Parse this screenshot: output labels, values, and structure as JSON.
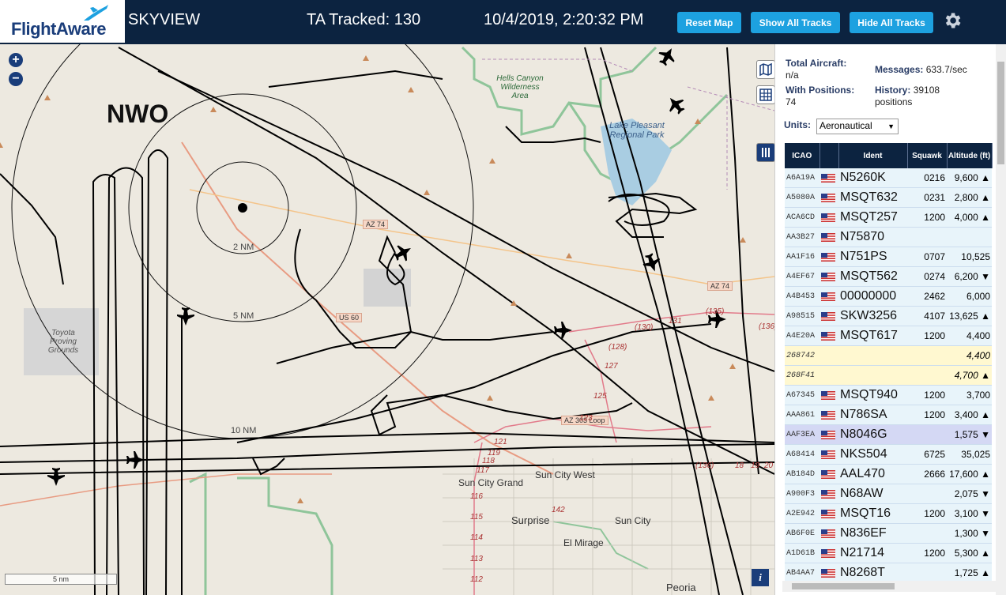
{
  "header": {
    "logo_text": "FlightAware",
    "app_title": "SKYVIEW",
    "ta_tracked": "TA Tracked: 130",
    "clock": "10/4/2019, 2:20:32 PM",
    "btn_reset": "Reset Map",
    "btn_show": "Show All Tracks",
    "btn_hide": "Hide All Tracks",
    "settings_icon": "gear-icon"
  },
  "map": {
    "station_label": "NWO",
    "zoom_in": "+",
    "zoom_out": "−",
    "range_rings": [
      "2 NM",
      "5 NM",
      "10 NM"
    ],
    "labels": {
      "hells_canyon": "Hells Canyon Wilderness Area",
      "lake_pleasant": "Lake Pleasant Regional Park",
      "toyota": "Toyota Proving Grounds",
      "sun_city_grand": "Sun City Grand",
      "sun_city_west": "Sun City West",
      "sun_city": "Sun City",
      "surprise": "Surprise",
      "el_mirage": "El Mirage",
      "peoria": "Peoria"
    },
    "roads": [
      "AZ 74",
      "AZ 74",
      "US 60",
      "AZ 303 Loop"
    ],
    "road_numbers": [
      "(130)",
      "131",
      "(135)",
      "(136)",
      "(128)",
      "127",
      "125",
      "123",
      "121",
      "119",
      "118",
      "117",
      "116",
      "115",
      "114",
      "113",
      "112",
      "142",
      "18",
      "19",
      "20",
      "(136)"
    ],
    "scale": "5 nm",
    "info": "i"
  },
  "panel": {
    "total_aircraft_label": "Total Aircraft:",
    "total_aircraft_value": "n/a",
    "with_positions_label": "With Positions:",
    "with_positions_value": "74",
    "messages_label": "Messages:",
    "messages_value": "633.7/sec",
    "history_label": "History:",
    "history_value": "39108",
    "history_unit": "positions",
    "units_label": "Units:",
    "units_value": "Aeronautical",
    "columns": [
      "ICAO",
      "",
      "Ident",
      "Squawk",
      "Altitude (ft)"
    ],
    "rows": [
      {
        "icao": "A6A19A",
        "ident": "N5260K",
        "squawk": "0216",
        "alt": "9,600 ▲",
        "type": "r"
      },
      {
        "icao": "A5080A",
        "ident": "MSQT632",
        "squawk": "0231",
        "alt": "2,800 ▲",
        "type": "r"
      },
      {
        "icao": "ACA6CD",
        "ident": "MSQT257",
        "squawk": "1200",
        "alt": "4,000 ▲",
        "type": "r"
      },
      {
        "icao": "AA3B27",
        "ident": "N75870",
        "squawk": "",
        "alt": "",
        "type": "r"
      },
      {
        "icao": "AA1F16",
        "ident": "N751PS",
        "squawk": "0707",
        "alt": "10,525",
        "type": "r"
      },
      {
        "icao": "A4EF67",
        "ident": "MSQT562",
        "squawk": "0274",
        "alt": "6,200 ▼",
        "type": "r"
      },
      {
        "icao": "A4B453",
        "ident": "00000000",
        "squawk": "2462",
        "alt": "6,000",
        "type": "r"
      },
      {
        "icao": "A98515",
        "ident": "SKW3256",
        "squawk": "4107",
        "alt": "13,625 ▲",
        "type": "r"
      },
      {
        "icao": "A4E20A",
        "ident": "MSQT617",
        "squawk": "1200",
        "alt": "4,400",
        "type": "r"
      },
      {
        "icao": "268742",
        "ident": "",
        "squawk": "",
        "alt": "4,400",
        "type": "alt"
      },
      {
        "icao": "268F41",
        "ident": "",
        "squawk": "",
        "alt": "4,700 ▲",
        "type": "alt"
      },
      {
        "icao": "A67345",
        "ident": "MSQT940",
        "squawk": "1200",
        "alt": "3,700",
        "type": "r"
      },
      {
        "icao": "AAA861",
        "ident": "N786SA",
        "squawk": "1200",
        "alt": "3,400 ▲",
        "type": "r"
      },
      {
        "icao": "AAF3EA",
        "ident": "N8046G",
        "squawk": "",
        "alt": "1,575 ▼",
        "type": "sel"
      },
      {
        "icao": "A68414",
        "ident": "NKS504",
        "squawk": "6725",
        "alt": "35,025",
        "type": "r"
      },
      {
        "icao": "AB184D",
        "ident": "AAL470",
        "squawk": "2666",
        "alt": "17,600 ▲",
        "type": "r"
      },
      {
        "icao": "A900F3",
        "ident": "N68AW",
        "squawk": "",
        "alt": "2,075 ▼",
        "type": "r"
      },
      {
        "icao": "A2E942",
        "ident": "MSQT16",
        "squawk": "1200",
        "alt": "3,100 ▼",
        "type": "r"
      },
      {
        "icao": "AB6F0E",
        "ident": "N836EF",
        "squawk": "",
        "alt": "1,300 ▼",
        "type": "r"
      },
      {
        "icao": "A1D61B",
        "ident": "N21714",
        "squawk": "1200",
        "alt": "5,300 ▲",
        "type": "r"
      },
      {
        "icao": "AB4AA7",
        "ident": "N8268T",
        "squawk": "",
        "alt": "1,725 ▲",
        "type": "r"
      }
    ]
  },
  "colors": {
    "header_bg": "#0c2340",
    "button": "#1da1e0",
    "row_bg": "#e8f4fa",
    "row_alt": "#fff8d0",
    "row_selected": "#d4d8f4"
  }
}
